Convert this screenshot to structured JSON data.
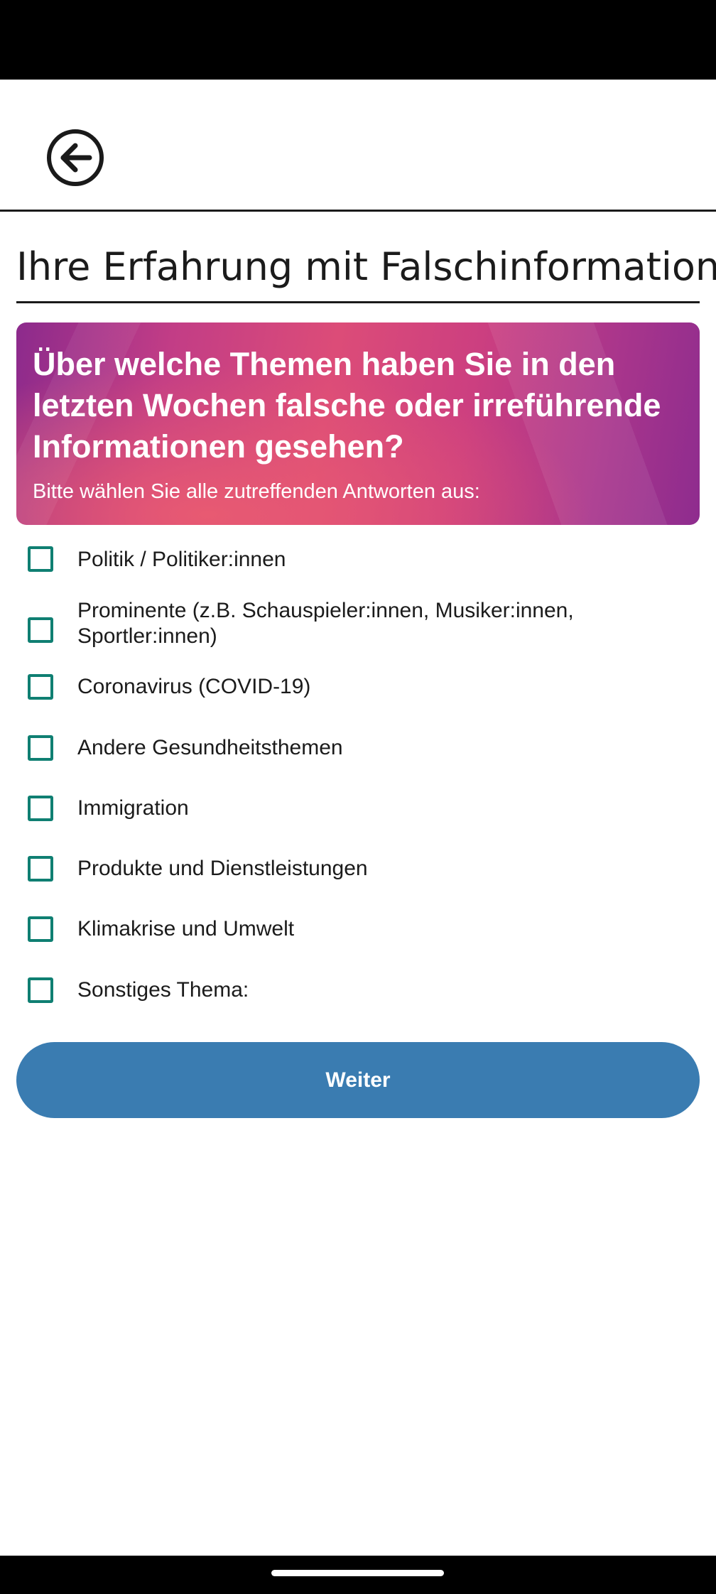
{
  "header": {
    "back_icon": "arrow-left-circle-icon"
  },
  "page": {
    "title": "Ihre Erfahrung mit Falschinformation"
  },
  "question": {
    "text": "Über welche Themen haben Sie in den letzten Wochen falsche oder irreführende Informationen gesehen?",
    "hint": "Bitte wählen Sie alle zutreffenden Antworten aus:"
  },
  "options": [
    {
      "label": "Politik / Politiker:innen",
      "checked": false
    },
    {
      "label": "Prominente (z.B. Schauspieler:innen, Musiker:innen, Sportler:innen)",
      "checked": false
    },
    {
      "label": "Coronavirus (COVID-19)",
      "checked": false
    },
    {
      "label": "Andere Gesundheitsthemen",
      "checked": false
    },
    {
      "label": "Immigration",
      "checked": false
    },
    {
      "label": "Produkte und Dienstleistungen",
      "checked": false
    },
    {
      "label": "Klimakrise und Umwelt",
      "checked": false
    },
    {
      "label": "Sonstiges Thema:",
      "checked": false
    }
  ],
  "actions": {
    "next_label": "Weiter"
  },
  "colors": {
    "checkbox_border": "#0f7f72",
    "button_bg": "#3a7cb1",
    "banner_gradient_start": "#8c2a8c",
    "banner_gradient_mid": "#dc4c78"
  }
}
